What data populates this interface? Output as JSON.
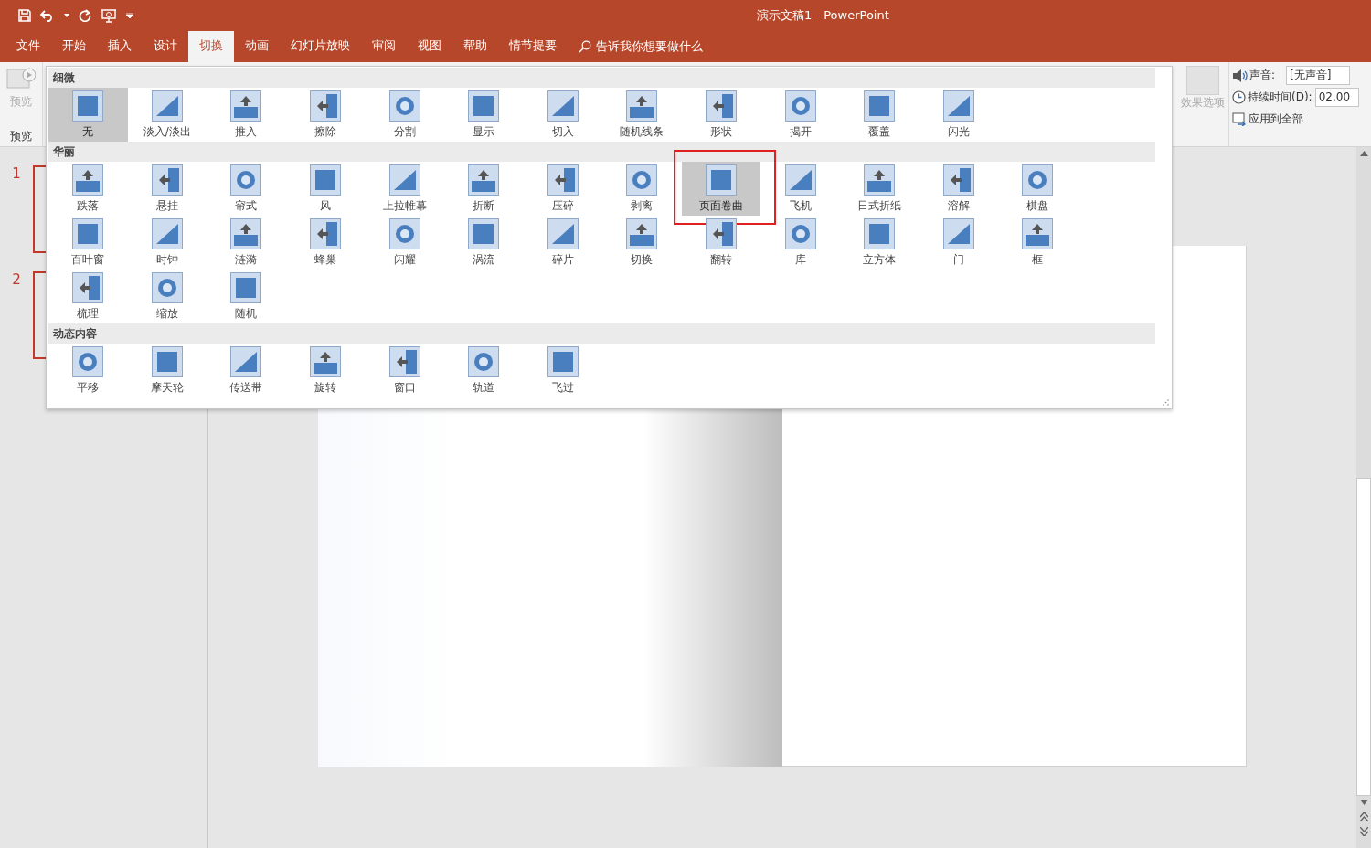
{
  "window": {
    "title": "演示文稿1 - PowerPoint"
  },
  "tabs": [
    {
      "label": "文件",
      "selected": false
    },
    {
      "label": "开始",
      "selected": false
    },
    {
      "label": "插入",
      "selected": false
    },
    {
      "label": "设计",
      "selected": false
    },
    {
      "label": "切换",
      "selected": true
    },
    {
      "label": "动画",
      "selected": false
    },
    {
      "label": "幻灯片放映",
      "selected": false
    },
    {
      "label": "审阅",
      "selected": false
    },
    {
      "label": "视图",
      "selected": false
    },
    {
      "label": "帮助",
      "selected": false
    },
    {
      "label": "情节提要",
      "selected": false
    }
  ],
  "search": {
    "placeholder": "告诉我你想要做什么"
  },
  "ribbon": {
    "preview_button": {
      "label": "预览",
      "disabled": true
    },
    "preview_group_label": "预览",
    "effect_options": {
      "label": "效果选项",
      "disabled": true
    },
    "sound": {
      "label": "声音:",
      "value": "[无声音]"
    },
    "duration": {
      "label": "持续时间(D):",
      "value": "02.00"
    },
    "apply_all": {
      "label": "应用到全部"
    }
  },
  "gallery": {
    "sections": [
      {
        "title": "细微",
        "items": [
          {
            "label": "无",
            "selected": true,
            "annotated": false
          },
          {
            "label": "淡入/淡出",
            "selected": false,
            "annotated": false
          },
          {
            "label": "推入",
            "selected": false,
            "annotated": false
          },
          {
            "label": "擦除",
            "selected": false,
            "annotated": false
          },
          {
            "label": "分割",
            "selected": false,
            "annotated": false
          },
          {
            "label": "显示",
            "selected": false,
            "annotated": false
          },
          {
            "label": "切入",
            "selected": false,
            "annotated": false
          },
          {
            "label": "随机线条",
            "selected": false,
            "annotated": false
          },
          {
            "label": "形状",
            "selected": false,
            "annotated": false
          },
          {
            "label": "揭开",
            "selected": false,
            "annotated": false
          },
          {
            "label": "覆盖",
            "selected": false,
            "annotated": false
          },
          {
            "label": "闪光",
            "selected": false,
            "annotated": false
          }
        ]
      },
      {
        "title": "华丽",
        "items": [
          {
            "label": "跌落",
            "selected": false,
            "annotated": false
          },
          {
            "label": "悬挂",
            "selected": false,
            "annotated": false
          },
          {
            "label": "帘式",
            "selected": false,
            "annotated": false
          },
          {
            "label": "风",
            "selected": false,
            "annotated": false
          },
          {
            "label": "上拉帷幕",
            "selected": false,
            "annotated": false
          },
          {
            "label": "折断",
            "selected": false,
            "annotated": false
          },
          {
            "label": "压碎",
            "selected": false,
            "annotated": false
          },
          {
            "label": "剥离",
            "selected": false,
            "annotated": false
          },
          {
            "label": "页面卷曲",
            "selected": true,
            "annotated": true
          },
          {
            "label": "飞机",
            "selected": false,
            "annotated": false
          },
          {
            "label": "日式折纸",
            "selected": false,
            "annotated": false
          },
          {
            "label": "溶解",
            "selected": false,
            "annotated": false
          },
          {
            "label": "棋盘",
            "selected": false,
            "annotated": false
          },
          {
            "label": "百叶窗",
            "selected": false,
            "annotated": false
          },
          {
            "label": "时钟",
            "selected": false,
            "annotated": false
          },
          {
            "label": "涟漪",
            "selected": false,
            "annotated": false
          },
          {
            "label": "蜂巢",
            "selected": false,
            "annotated": false
          },
          {
            "label": "闪耀",
            "selected": false,
            "annotated": false
          },
          {
            "label": "涡流",
            "selected": false,
            "annotated": false
          },
          {
            "label": "碎片",
            "selected": false,
            "annotated": false
          },
          {
            "label": "切换",
            "selected": false,
            "annotated": false
          },
          {
            "label": "翻转",
            "selected": false,
            "annotated": false
          },
          {
            "label": "库",
            "selected": false,
            "annotated": false
          },
          {
            "label": "立方体",
            "selected": false,
            "annotated": false
          },
          {
            "label": "门",
            "selected": false,
            "annotated": false
          },
          {
            "label": "框",
            "selected": false,
            "annotated": false
          },
          {
            "label": "梳理",
            "selected": false,
            "annotated": false
          },
          {
            "label": "缩放",
            "selected": false,
            "annotated": false
          },
          {
            "label": "随机",
            "selected": false,
            "annotated": false
          }
        ]
      },
      {
        "title": "动态内容",
        "items": [
          {
            "label": "平移",
            "selected": false,
            "annotated": false
          },
          {
            "label": "摩天轮",
            "selected": false,
            "annotated": false
          },
          {
            "label": "传送带",
            "selected": false,
            "annotated": false
          },
          {
            "label": "旋转",
            "selected": false,
            "annotated": false
          },
          {
            "label": "窗口",
            "selected": false,
            "annotated": false
          },
          {
            "label": "轨道",
            "selected": false,
            "annotated": false
          },
          {
            "label": "飞过",
            "selected": false,
            "annotated": false
          }
        ]
      }
    ]
  },
  "slides": [
    {
      "number": "1",
      "selected": true
    },
    {
      "number": "2",
      "selected": true
    }
  ]
}
